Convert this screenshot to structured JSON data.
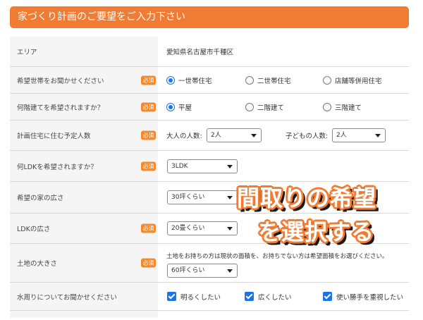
{
  "header": {
    "title": "家づくり計画のご要望をご入力下さい"
  },
  "required_label": "必須",
  "rows": {
    "area": {
      "label": "エリア",
      "value": "愛知県名古屋市千種区"
    },
    "household": {
      "label": "希望世帯をお聞かせください",
      "options": [
        {
          "label": "一世帯住宅",
          "checked": true
        },
        {
          "label": "二世帯住宅",
          "checked": false
        },
        {
          "label": "店舗等併用住宅",
          "checked": false
        }
      ]
    },
    "floors": {
      "label": "何階建てを希望されますか？",
      "options": [
        {
          "label": "平屋",
          "checked": true
        },
        {
          "label": "二階建て",
          "checked": false
        },
        {
          "label": "三階建て",
          "checked": false
        }
      ]
    },
    "people": {
      "label": "計画住宅に住む予定人数",
      "adults_label": "大人の人数:",
      "adults_value": "2人",
      "children_label": "子どもの人数:",
      "children_value": "2人"
    },
    "ldk": {
      "label": "何LDKを希望されますか？",
      "value": "3LDK"
    },
    "house_size": {
      "label": "希望の家の広さ",
      "value": "30坪くらい"
    },
    "ldk_size": {
      "label": "LDKの広さ",
      "value": "20畳くらい"
    },
    "land": {
      "label": "土地の大きさ",
      "note": "土地をお持ちの方は現状の面積を、お持ちでない方は希望面積をお選びください。",
      "value": "60坪くらい"
    },
    "water": {
      "label": "水周りについてお聞かせください",
      "options": [
        {
          "label": "明るくしたい",
          "checked": true
        },
        {
          "label": "広くしたい",
          "checked": true
        },
        {
          "label": "使い勝手を重視したい",
          "checked": true
        }
      ]
    }
  },
  "overlay": {
    "line1": "間取りの希望",
    "line2": "を選択する"
  }
}
